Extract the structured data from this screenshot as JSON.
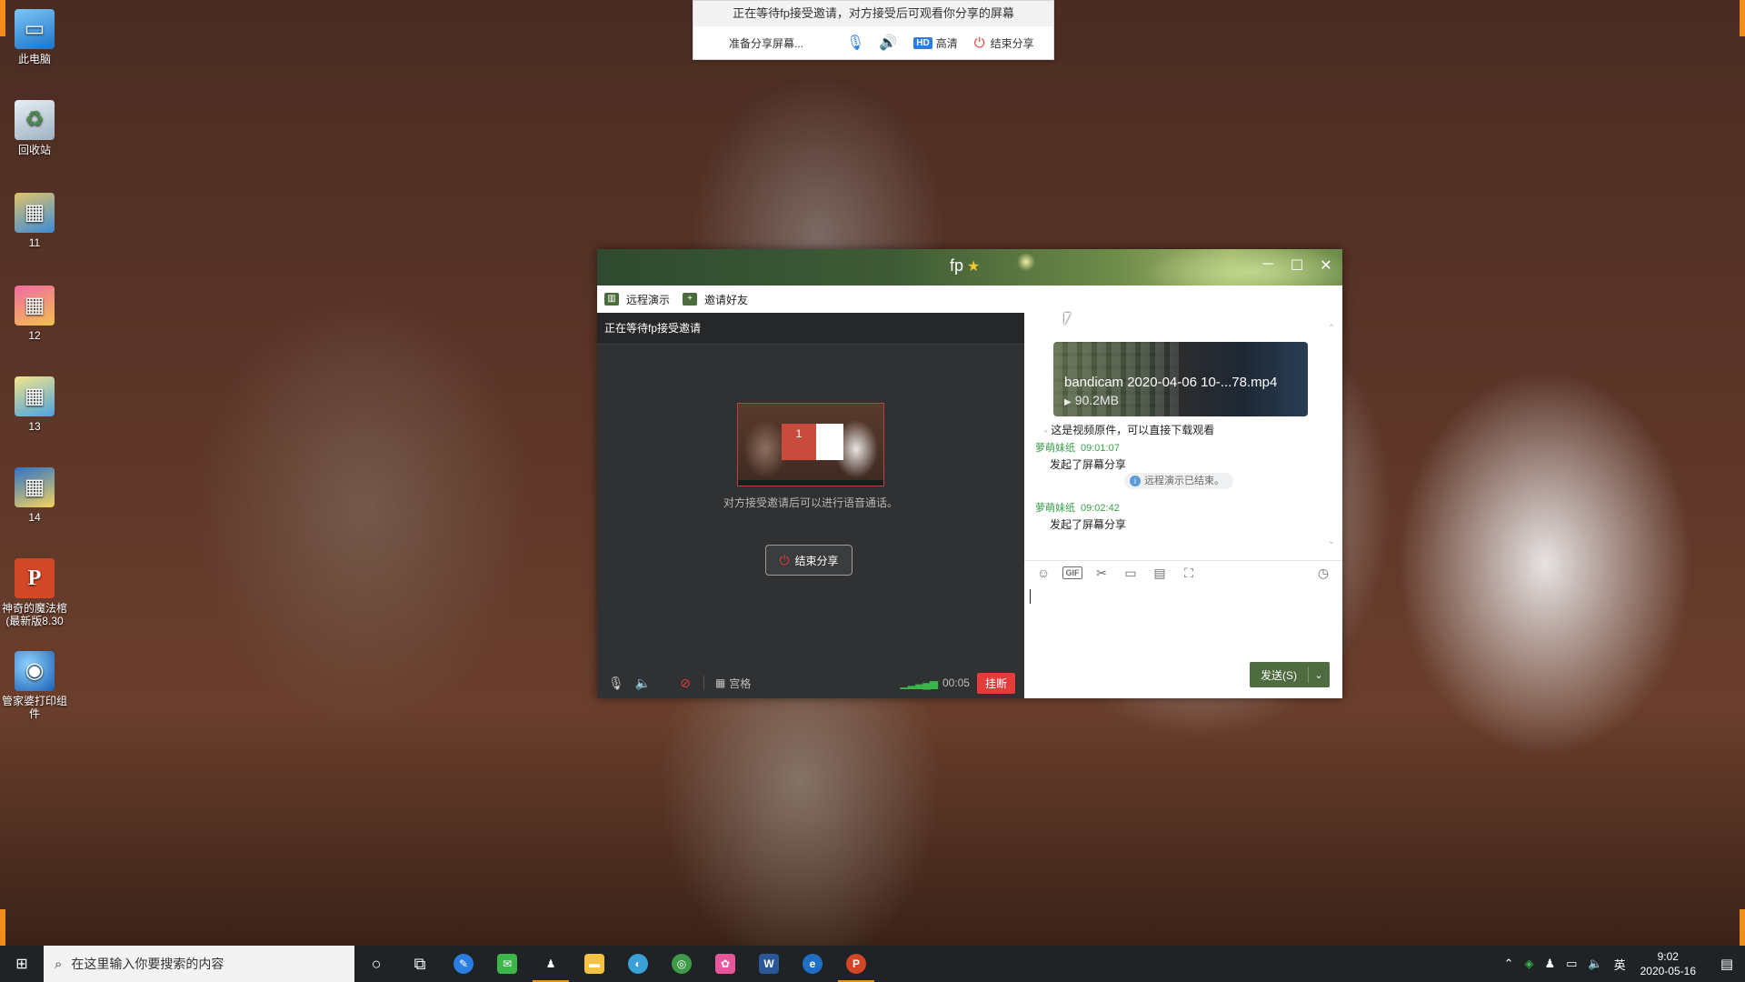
{
  "desktop": {
    "icons": [
      {
        "label": "此电脑",
        "icon": "computer-icon",
        "glyph": "▭"
      },
      {
        "label": "回收站",
        "icon": "recycle-bin-icon",
        "glyph": "♻"
      },
      {
        "label": "11",
        "icon": "image-file-icon",
        "glyph": "▦"
      },
      {
        "label": "12",
        "icon": "image-file-icon",
        "glyph": "▦"
      },
      {
        "label": "13",
        "icon": "image-file-icon",
        "glyph": "▦"
      },
      {
        "label": "14",
        "icon": "image-file-icon",
        "glyph": "▦"
      },
      {
        "label": "神奇的魔法棺(最新版8.30",
        "icon": "powerpoint-icon",
        "glyph": "P"
      },
      {
        "label": "管家婆打印组件",
        "icon": "globe-app-icon",
        "glyph": "◉"
      }
    ]
  },
  "share_bar": {
    "message": "正在等待fp接受邀请，对方接受后可观看你分享的屏幕",
    "status": "准备分享屏幕...",
    "hd_badge": "HD",
    "quality": "高清",
    "end_share": "结束分享"
  },
  "chat_window": {
    "title": "fp",
    "toolbar": {
      "remote_demo": "远程演示",
      "invite_friend": "邀请好友"
    },
    "call": {
      "header": "正在等待fp接受邀请",
      "preview_badge": "1",
      "note": "对方接受邀请后可以进行语音通话。",
      "end_share_button": "结束分享",
      "grid_label": "宫格",
      "timer": "00:05",
      "hangup": "挂断"
    },
    "messages": {
      "video_file": {
        "name": "bandicam 2020-04-06 10-...78.mp4",
        "size": "90.2MB"
      },
      "caption": "这是视频原件，可以直接下载观看",
      "entries": [
        {
          "sender": "萝萌妹纸",
          "time": "09:01:07",
          "text": "发起了屏幕分享"
        },
        {
          "sender": "萝萌妹纸",
          "time": "09:02:42",
          "text": "发起了屏幕分享"
        }
      ],
      "system_notice": "远程演示已结束。"
    },
    "send": {
      "label": "发送(S)"
    }
  },
  "taskbar": {
    "search_placeholder": "在这里输入你要搜索的内容",
    "apps": [
      {
        "name": "cortana",
        "glyph": "○",
        "color": "#1f2326"
      },
      {
        "name": "task-view",
        "glyph": "⧉",
        "color": "#1f2326"
      },
      {
        "name": "feather-app",
        "glyph": "✎",
        "color": "#2a7de1"
      },
      {
        "name": "wechat",
        "glyph": "✉",
        "color": "#3bb54a"
      },
      {
        "name": "qq",
        "glyph": "♟",
        "color": "#1f2326"
      },
      {
        "name": "file-explorer",
        "glyph": "▬",
        "color": "#f5c342"
      },
      {
        "name": "edge-alt",
        "glyph": "◐",
        "color": "#3aa0d8"
      },
      {
        "name": "chrome",
        "glyph": "◎",
        "color": "#3f9b48"
      },
      {
        "name": "pink-app",
        "glyph": "✿",
        "color": "#e8579c"
      },
      {
        "name": "word",
        "glyph": "W",
        "color": "#2b5797"
      },
      {
        "name": "ie",
        "glyph": "e",
        "color": "#1f6fc5"
      },
      {
        "name": "powerpoint",
        "glyph": "P",
        "color": "#d24726"
      }
    ],
    "ime": "英",
    "time": "9:02",
    "date": "2020-05-16"
  },
  "colors": {
    "accent_orange": "#f28c1a",
    "hangup_red": "#e63b3b",
    "send_green": "#4f6b40",
    "sender_green": "#3aa04a"
  }
}
